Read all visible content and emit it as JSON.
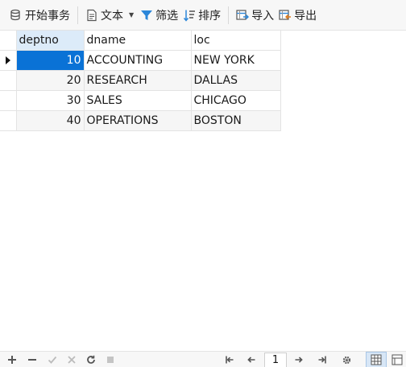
{
  "toolbar": {
    "begin_transaction": "开始事务",
    "text": "文本",
    "filter": "筛选",
    "sort": "排序",
    "import": "导入",
    "export": "导出"
  },
  "grid": {
    "columns": [
      "deptno",
      "dname",
      "loc"
    ],
    "rows": [
      [
        "10",
        "ACCOUNTING",
        "NEW YORK"
      ],
      [
        "20",
        "RESEARCH",
        "DALLAS"
      ],
      [
        "30",
        "SALES",
        "CHICAGO"
      ],
      [
        "40",
        "OPERATIONS",
        "BOSTON"
      ]
    ],
    "selected_column": "deptno"
  },
  "statusbar": {
    "page": "1",
    "icons": {
      "add": "plus-icon",
      "delete": "minus-icon",
      "apply": "check-icon",
      "discard": "x-icon",
      "refresh": "refresh-icon",
      "stop": "stop-icon",
      "first": "first-page-icon",
      "prev": "prev-page-icon",
      "next": "next-page-icon",
      "last": "last-page-icon",
      "settings": "gear-icon",
      "grid_view": "grid-view-icon",
      "form_view": "form-view-icon"
    }
  },
  "colors": {
    "active_cell": "#0a72d6",
    "header_selected": "#dcebf9",
    "filter_icon": "#2b86d9"
  }
}
